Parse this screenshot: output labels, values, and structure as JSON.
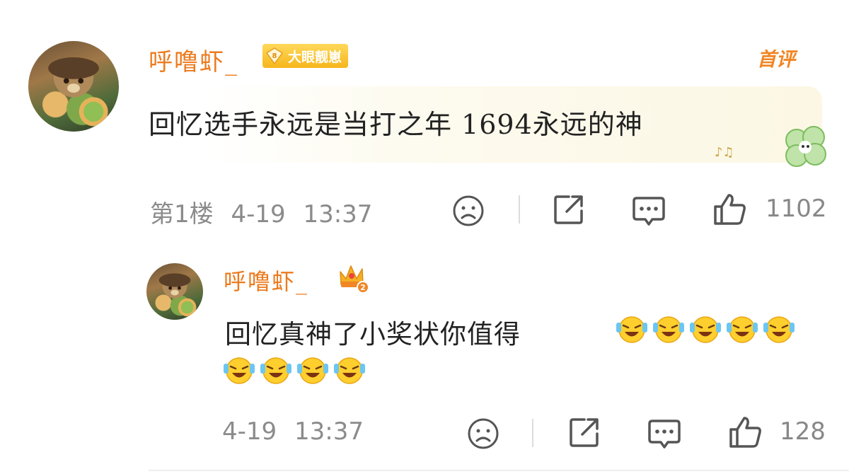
{
  "comment": {
    "username": "呼噜虾_",
    "level_badge": {
      "level": "8",
      "text": "大眼靓崽"
    },
    "first_tag": "首评",
    "text": "回忆选手永远是当打之年 1694永远的神",
    "floor": "第1楼",
    "date": "4-19",
    "time": "13:37",
    "likes": "1102",
    "icons": [
      "sad-face-icon",
      "share-icon",
      "comment-icon",
      "thumbs-up-icon"
    ]
  },
  "reply": {
    "username": "呼噜虾_",
    "crown_level": "2",
    "text": "回忆真神了小奖状你值得",
    "emoji_count_line1": 5,
    "emoji_count_line2": 4,
    "date": "4-19",
    "time": "13:37",
    "likes": "128",
    "icons": [
      "sad-face-icon",
      "share-icon",
      "comment-icon",
      "thumbs-up-icon"
    ]
  },
  "colors": {
    "username": "#ec7b1e",
    "badge": "#f6b51c",
    "meta_text": "#8b8b8b",
    "body_text": "#222222"
  }
}
